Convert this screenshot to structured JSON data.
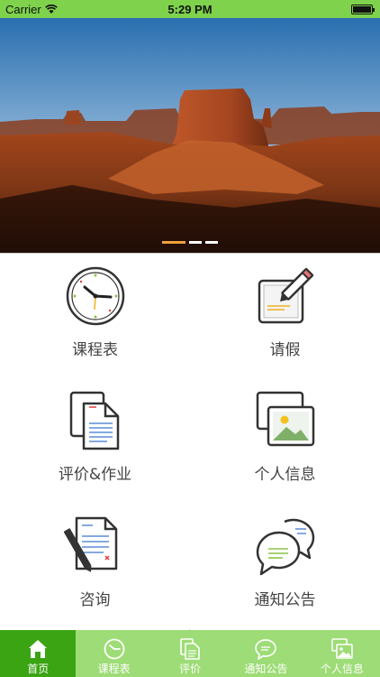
{
  "status_bar": {
    "carrier": "Carrier",
    "time": "5:29 PM"
  },
  "banner": {
    "page_count": 3,
    "active_page": 1
  },
  "grid": [
    {
      "label": "课程表",
      "icon": "clock-icon"
    },
    {
      "label": "请假",
      "icon": "notepad-pencil-icon"
    },
    {
      "label": "评价&作业",
      "icon": "documents-icon"
    },
    {
      "label": "个人信息",
      "icon": "photo-frame-icon"
    },
    {
      "label": "咨询",
      "icon": "document-pen-icon"
    },
    {
      "label": "通知公告",
      "icon": "chat-bubbles-icon"
    }
  ],
  "tabbar": {
    "active_index": 0,
    "items": [
      {
        "label": "首页",
        "icon": "home-icon"
      },
      {
        "label": "课程表",
        "icon": "clock-icon"
      },
      {
        "label": "评价",
        "icon": "document-icon"
      },
      {
        "label": "通知公告",
        "icon": "chat-icon"
      },
      {
        "label": "个人信息",
        "icon": "photo-icon"
      }
    ]
  },
  "colors": {
    "status_bar": "#7ed24c",
    "tabbar": "#9ddc76",
    "tabbar_active": "#3aa413",
    "pager_active": "#f0a13c",
    "icon_green": "#8bc34a"
  }
}
